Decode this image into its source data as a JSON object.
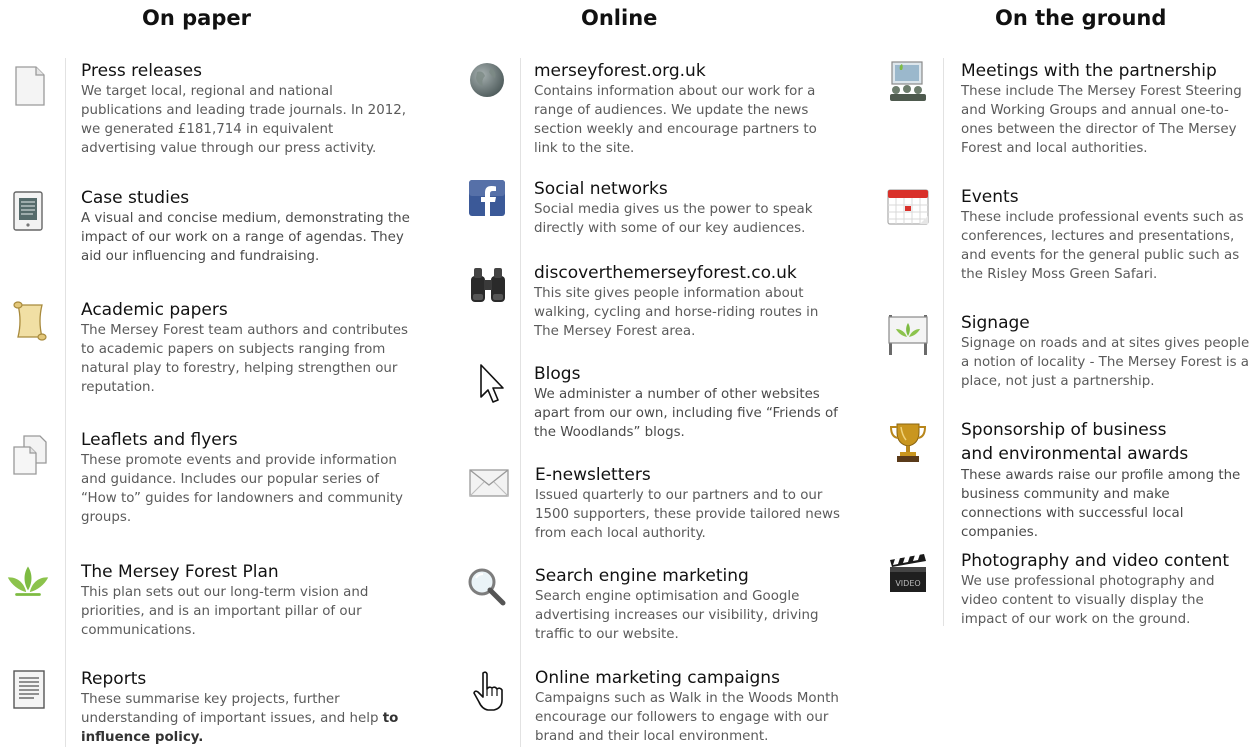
{
  "columns": {
    "paper": {
      "heading": "On paper",
      "items": [
        {
          "icon": "document-icon",
          "title": "Press releases",
          "desc": "We target local, regional and national publications and leading trade journals. In 2012, we generated £181,714 in equivalent advertising value through our press activity."
        },
        {
          "icon": "tablet-document-icon",
          "title": "Case studies",
          "desc": "A visual and concise medium, demonstrating the impact of our work on a range of agendas. They aid our influencing and fundraising."
        },
        {
          "icon": "scroll-icon",
          "title": "Academic papers",
          "desc": "The Mersey Forest team authors and contributes to academic papers on subjects ranging from natural play to forestry, helping strengthen our reputation."
        },
        {
          "icon": "stacked-pages-icon",
          "title": "Leaflets and flyers",
          "desc": "These promote events and provide information and guidance. Includes our popular series of “How to” guides for landowners and community groups."
        },
        {
          "icon": "mersey-forest-leaf-icon",
          "title": "The Mersey Forest Plan",
          "desc": "This plan sets out our long-term vision and priorities, and is an important pillar of our communications."
        },
        {
          "icon": "report-icon",
          "title": "Reports",
          "desc": "These summarise key projects, further understanding of important issues, and help",
          "desc_tail": "to influence policy."
        }
      ]
    },
    "online": {
      "heading": "Online",
      "items": [
        {
          "icon": "globe-icon",
          "title": "merseyforest.org.uk",
          "desc": "Contains information about our work for a range of audiences. We update the news section weekly and encourage partners to link to the site."
        },
        {
          "icon": "facebook-icon",
          "title": "Social networks",
          "desc": "Social media gives us the power to speak directly with some of our key audiences."
        },
        {
          "icon": "binoculars-icon",
          "title": "discoverthemerseyforest.co.uk",
          "desc": "This site gives people information about walking, cycling and horse-riding routes in The Mersey Forest area."
        },
        {
          "icon": "cursor-arrow-icon",
          "title": "Blogs",
          "desc": "We administer a number of other websites apart from our own, including five “Friends of the Woodlands” blogs."
        },
        {
          "icon": "envelope-icon",
          "title": "E-newsletters",
          "desc": "Issued quarterly to our partners and to our 1500 supporters, these provide tailored news from each local authority."
        },
        {
          "icon": "magnifier-icon",
          "title": "Search engine marketing",
          "desc": "Search engine optimisation and Google advertising increases our visibility, driving traffic to our website."
        },
        {
          "icon": "hand-pointer-icon",
          "title": "Online marketing campaigns",
          "desc": "Campaigns such as Walk in the Woods Month encourage our followers to engage with our brand and their local environment."
        }
      ]
    },
    "ground": {
      "heading": "On the ground",
      "items": [
        {
          "icon": "meeting-icon",
          "title": "Meetings with the partnership",
          "desc": "These include The Mersey Forest Steering and Working Groups and annual one-to-ones between the director of The Mersey Forest and local authorities."
        },
        {
          "icon": "calendar-icon",
          "title": "Events",
          "desc": "These include professional events such as conferences, lectures and presentations, and events for the general public such as the Risley Moss Green Safari."
        },
        {
          "icon": "signboard-icon",
          "title": "Signage",
          "desc": "Signage on roads and at sites gives people a notion of locality - The Mersey Forest is a place, not just a partnership."
        },
        {
          "icon": "trophy-icon",
          "title": "Sponsorship of business and environmental awards",
          "desc": "These awards raise our profile among the business community and make connections with successful local companies."
        },
        {
          "icon": "clapperboard-icon",
          "title": "Photography and video content",
          "desc": "We use professional photography and video content to visually display the impact of our work on the ground.",
          "clapper_text": "VIDEO"
        }
      ]
    }
  }
}
